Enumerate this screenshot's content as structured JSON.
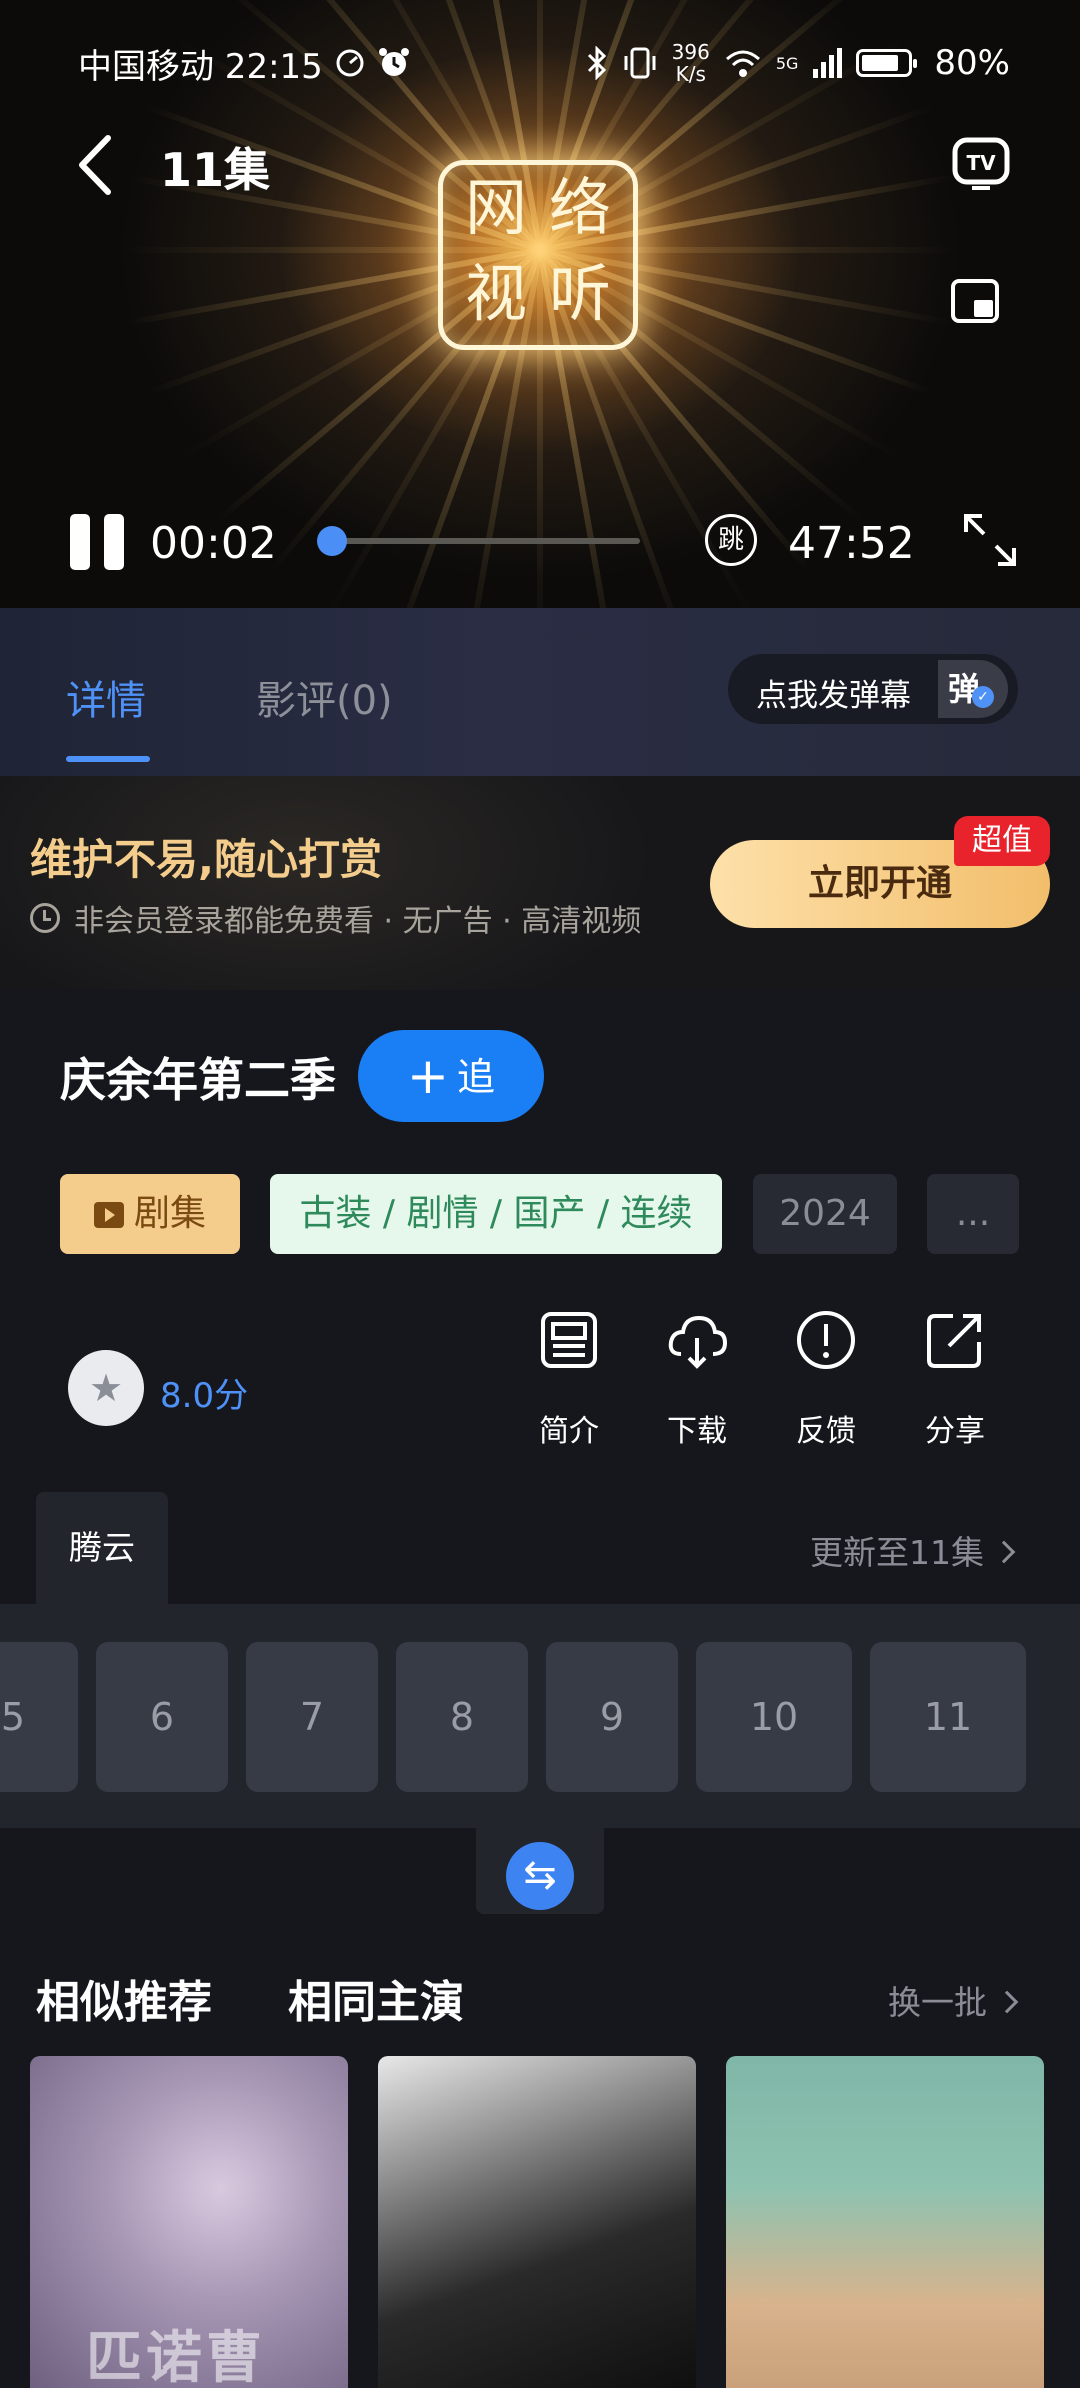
{
  "status_bar": {
    "carrier_time": "中国移动 22:15",
    "net_speed_value": "396",
    "net_speed_unit": "K/s",
    "signal_label": "5G",
    "battery": "80%"
  },
  "player": {
    "episode_title": "11集",
    "current_time": "00:02",
    "total_time": "47:52",
    "progress_fraction": 0.0007,
    "skip_label": "跳",
    "logo_chars": [
      "网",
      "络",
      "视",
      "听"
    ]
  },
  "tabs": {
    "detail": "详情",
    "review": "影评(0)",
    "danmaku_prompt": "点我发弹幕",
    "danmaku_icon": "弹"
  },
  "promo": {
    "title": "维护不易,随心打赏",
    "subtitle": "非会员登录都能免费看 · 无广告 · 高清视频",
    "button": "立即开通",
    "badge": "超值"
  },
  "show": {
    "title": "庆余年第二季",
    "follow_label": "追",
    "tags": {
      "type": "剧集",
      "genres": "古装 / 剧情 / 国产 / 连续",
      "year": "2024",
      "more": "..."
    },
    "rating": "8.0分"
  },
  "actions": [
    {
      "label": "简介",
      "icon": "document-icon"
    },
    {
      "label": "下载",
      "icon": "cloud-download-icon"
    },
    {
      "label": "反馈",
      "icon": "alert-circle-icon"
    },
    {
      "label": "分享",
      "icon": "share-icon"
    }
  ],
  "episodes": {
    "source": "腾云",
    "updated_to": "更新至11集",
    "list": [
      "5",
      "6",
      "7",
      "8",
      "9",
      "10",
      "11"
    ]
  },
  "recommend": {
    "tab_similar": "相似推荐",
    "tab_same_cast": "相同主演",
    "refresh": "换一批",
    "poster_1_caption": "匹诺曹"
  },
  "colors": {
    "accent_blue": "#4f92f7",
    "follow_blue": "#1a7ef5",
    "gold": "#f4cd8d",
    "badge_red": "#e8232b",
    "background": "#16171c"
  }
}
